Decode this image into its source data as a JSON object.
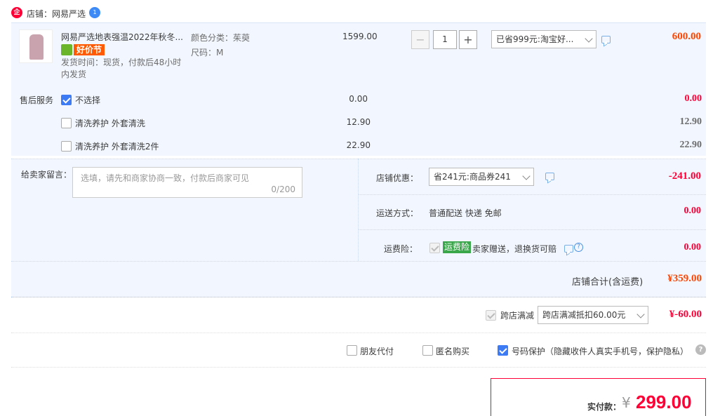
{
  "shop": {
    "label": "店铺：网易严选"
  },
  "item": {
    "title": "网易严选地表强温2022年秋冬...",
    "promo_badge": "好价节",
    "delivery": "发货时间：现货，付款后48小时内发货",
    "color_label": "颜色分类：茱萸",
    "size_label": "尺码：M",
    "unit_price": "1599.00",
    "quantity": "1",
    "discount_select": "已省999元:淘宝好...",
    "subtotal": "600.00"
  },
  "after_sale": {
    "label": "售后服务",
    "options": [
      {
        "name": "不选择",
        "price": "0.00",
        "total": "0.00",
        "checked": true
      },
      {
        "name": "清洗养护 外套清洗",
        "price": "12.90",
        "total": "12.90",
        "checked": false
      },
      {
        "name": "清洗养护 外套清洗2件",
        "price": "22.90",
        "total": "22.90",
        "checked": false
      }
    ]
  },
  "message": {
    "label": "给卖家留言：",
    "placeholder": "选填，请先和商家协商一致，付款后商家可见",
    "counter": "0/200"
  },
  "shop_discount": {
    "label": "店铺优惠：",
    "select": "省241元:商品券241",
    "amount": "-241.00"
  },
  "shipping": {
    "label": "运送方式：",
    "value": "普通配送 快递 免邮",
    "amount": "0.00"
  },
  "freight_insurance": {
    "label": "运费险：",
    "tag": "运费险",
    "text": "卖家赠送，退换货可赔",
    "amount": "0.00"
  },
  "shop_total": {
    "label": "店铺合计(含运费)",
    "amount": "¥359.00"
  },
  "cross_shop": {
    "label": "跨店满减",
    "select": "跨店满减抵扣60.00元",
    "amount": "¥-60.00"
  },
  "options": {
    "friend_pay": "朋友代付",
    "anonymous": "匿名购买",
    "privacy": "号码保护（隐藏收件人真实手机号，保护隐私）"
  },
  "payment": {
    "label": "实付款：",
    "currency": "¥",
    "amount": "299.00"
  },
  "colors": {
    "accent_red": "#ff0036",
    "price_orange": "#ff4400",
    "panel_bg": "#f2f7ff",
    "checkbox_blue": "#3d7bf5"
  }
}
